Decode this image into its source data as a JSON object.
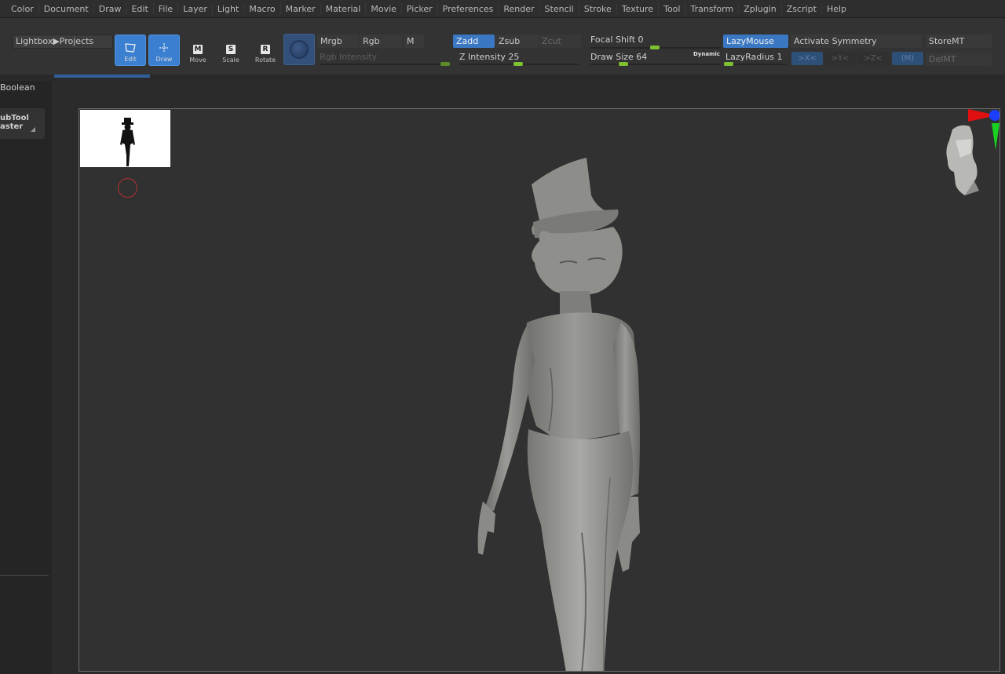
{
  "menubar": {
    "items": [
      "Color",
      "Document",
      "Draw",
      "Edit",
      "File",
      "Layer",
      "Light",
      "Macro",
      "Marker",
      "Material",
      "Movie",
      "Picker",
      "Preferences",
      "Render",
      "Stencil",
      "Stroke",
      "Texture",
      "Tool",
      "Transform",
      "Zplugin",
      "Zscript",
      "Help"
    ]
  },
  "toolbar": {
    "lightbox": "Lightbox▶Projects",
    "edit": "Edit",
    "draw": "Draw",
    "move": "Move",
    "scale": "Scale",
    "rotate": "Rotate",
    "mrgb": "Mrgb",
    "rgb": "Rgb",
    "m": "M",
    "rgb_intensity": "Rgb Intensity",
    "zadd": "Zadd",
    "zsub": "Zsub",
    "zcut": "Zcut",
    "z_intensity": "Z Intensity 25",
    "focal_shift": "Focal Shift 0",
    "draw_size": "Draw Size 64",
    "dynamic": "Dynamic",
    "lazymouse": "LazyMouse",
    "lazyradius": "LazyRadius 1",
    "activate_symmetry": "Activate Symmetry",
    "axis_x": ">X<",
    "axis_y": ">Y<",
    "axis_z": ">Z<",
    "axis_m": "(M)",
    "storemt": "StoreMT",
    "delmt": "DelMT",
    "z_intensity_value": 25,
    "focal_shift_value": 0,
    "draw_size_value": 64,
    "lazyradius_value": 1
  },
  "left_panel": {
    "boolean": "Boolean",
    "subtool_line1": "ubTool",
    "subtool_line2": "aster"
  },
  "colors": {
    "accent_blue": "#3b78c4",
    "slider_green": "#7ec033",
    "canvas_bg": "#313131",
    "model_gray": "#8a8a86"
  },
  "icons": {
    "edit": "edit-icon",
    "draw": "draw-icon",
    "move": "move-icon",
    "scale": "scale-icon",
    "rotate": "rotate-icon",
    "material": "material-sphere-icon",
    "gizmo": "orientation-head-icon"
  }
}
